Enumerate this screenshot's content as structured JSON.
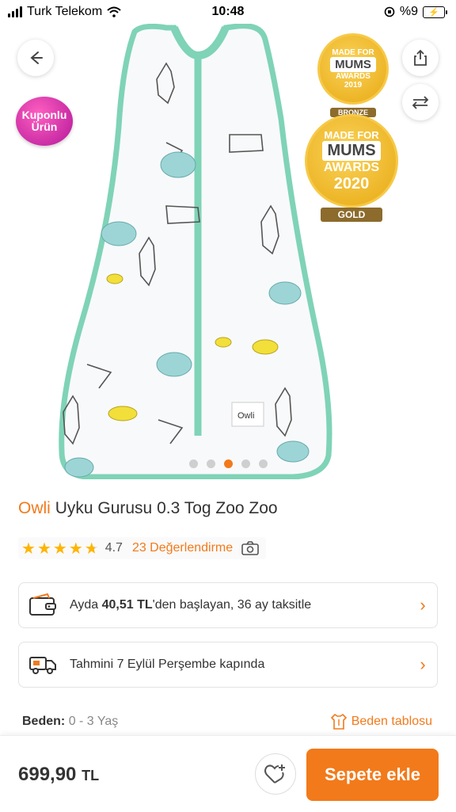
{
  "status_bar": {
    "carrier": "Turk Telekom",
    "time": "10:48",
    "battery": "%9"
  },
  "hero": {
    "coupon_badge_line1": "Kuponlu",
    "coupon_badge_line2": "Ürün",
    "award_bronze": {
      "line1": "MADE FOR",
      "line2": "MUMS",
      "line3": "AWARDS",
      "year": "2019",
      "ribbon": "BRONZE"
    },
    "award_gold": {
      "line1": "MADE FOR",
      "line2": "MUMS",
      "line3": "AWARDS",
      "year": "2020",
      "ribbon": "GOLD"
    },
    "carousel_count": 5,
    "carousel_active_index": 2,
    "label_tag": "Owli"
  },
  "product": {
    "brand": "Owli",
    "name": "Uyku Gurusu 0.3 Tog Zoo Zoo"
  },
  "rating": {
    "score": "4.7",
    "stars": 4.7,
    "reviews": "23 Değerlendirme"
  },
  "installment": {
    "prefix": "Ayda ",
    "amount": "40,51 TL",
    "suffix": "'den başlayan, 36 ay taksitle"
  },
  "delivery": {
    "text": "Tahmini 7 Eylül Perşembe kapında"
  },
  "size": {
    "label": "Beden:",
    "value": "0 - 3 Yaş",
    "table_link": "Beden tablosu"
  },
  "bottom_bar": {
    "price": "699,90",
    "currency": "TL",
    "add_to_cart": "Sepete ekle"
  },
  "colors": {
    "accent": "#f27a1a",
    "mint": "#7fd3b7"
  }
}
